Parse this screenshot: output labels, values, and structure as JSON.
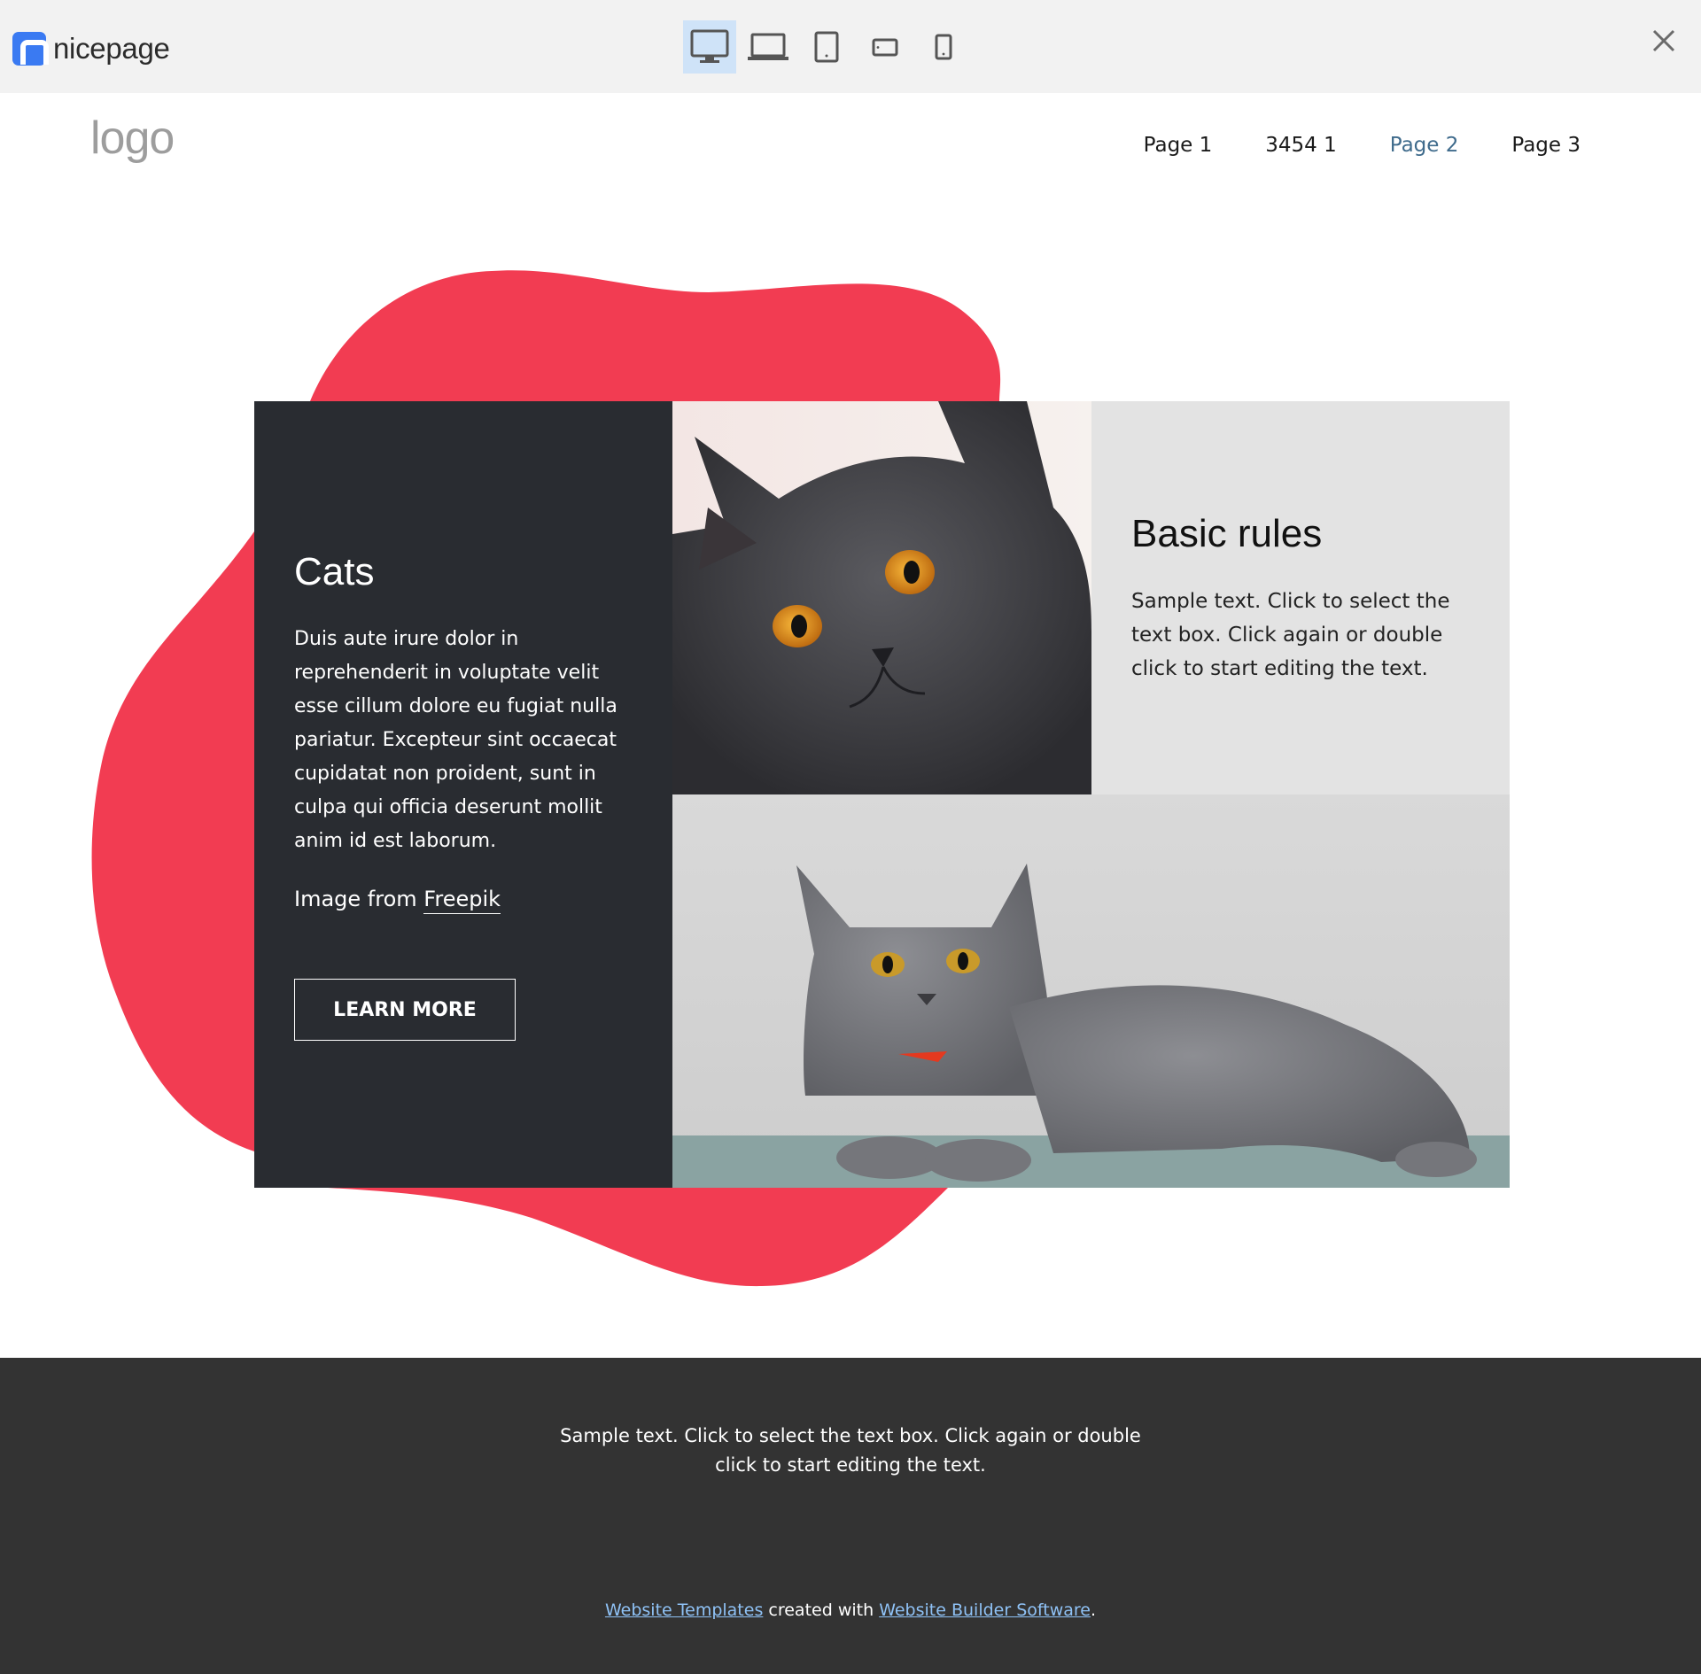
{
  "preview_bar": {
    "brand_name": "nicepage",
    "devices": [
      {
        "icon": "desktop-icon",
        "active": true
      },
      {
        "icon": "laptop-icon",
        "active": false
      },
      {
        "icon": "tablet-icon",
        "active": false
      },
      {
        "icon": "phone-landscape-icon",
        "active": false
      },
      {
        "icon": "phone-icon",
        "active": false
      }
    ],
    "close_icon": "close-icon"
  },
  "header": {
    "logo_text": "logo",
    "nav": [
      {
        "label": "Page 1",
        "current": false
      },
      {
        "label": "3454 1",
        "current": false
      },
      {
        "label": "Page 2",
        "current": true
      },
      {
        "label": "Page 3",
        "current": false
      }
    ]
  },
  "feature": {
    "title": "Cats",
    "description": "Duis aute irure dolor in reprehenderit in voluptate velit esse cillum dolore eu fugiat nulla pariatur. Excepteur sint occaecat cupidatat non proident, sunt in culpa qui officia deserunt mollit anim id est laborum.",
    "credit_prefix": "Image from",
    "credit_link": "Freepik",
    "button_label": "LEARN MORE"
  },
  "rules": {
    "title": "Basic rules",
    "text": "Sample text. Click to select the text box. Click again or double click to start editing the text."
  },
  "footer": {
    "text_line1": "Sample text. Click to select the text box. Click again or double",
    "text_line2": "click to start editing the text.",
    "credit_link1": "Website Templates",
    "credit_middle": "created with",
    "credit_link2": "Website Builder Software",
    "credit_end": "."
  },
  "colors": {
    "accent_blob": "#f23c52",
    "dark_card": "#292c31",
    "light_card": "#e3e3e3",
    "footer_bg": "#333333",
    "brand_blue": "#3a7af2",
    "nav_current": "#3f6b8c",
    "footer_link": "#8fc2f6"
  }
}
